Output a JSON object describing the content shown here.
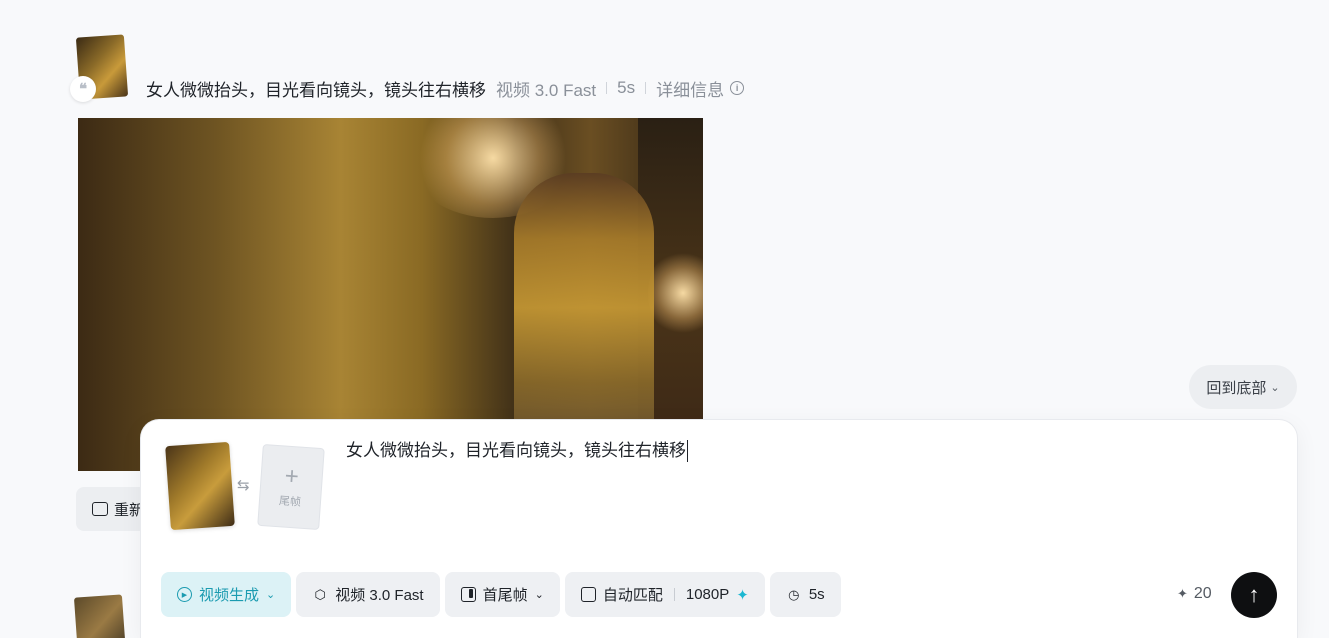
{
  "message": {
    "quote_glyph": "❝",
    "prompt": "女人微微抬头，目光看向镜头，镜头往右横移",
    "model": "视频 3.0 Fast",
    "duration": "5s",
    "details_label": "详细信息",
    "info_glyph": "i"
  },
  "actions": {
    "regenerate_label": "重新"
  },
  "back_to_bottom": {
    "label": "回到底部",
    "icon": "double-chevron-down-icon",
    "glyph": "⌄"
  },
  "composer": {
    "swap_glyph": "⇆",
    "last_frame_plus": "+",
    "last_frame_label": "尾帧",
    "prompt_value": "女人微微抬头，目光看向镜头，镜头往右横移",
    "mode": {
      "label": "视频生成",
      "icon": "video-generate-icon"
    },
    "model": {
      "label": "视频 3.0 Fast",
      "icon": "cube-icon"
    },
    "frames": {
      "label": "首尾帧",
      "icon": "frame-icon"
    },
    "ratio": {
      "label": "自动匹配",
      "resolution": "1080P",
      "icon": "aspect-ratio-icon",
      "spark_glyph": "✦"
    },
    "duration": {
      "label": "5s",
      "icon": "clock-icon",
      "glyph": "◷"
    },
    "chevron_glyph": "⌄",
    "credits": {
      "value": "20",
      "glyph": "✦"
    },
    "send_glyph": "↑",
    "accent_color": "#1b9bb0"
  }
}
